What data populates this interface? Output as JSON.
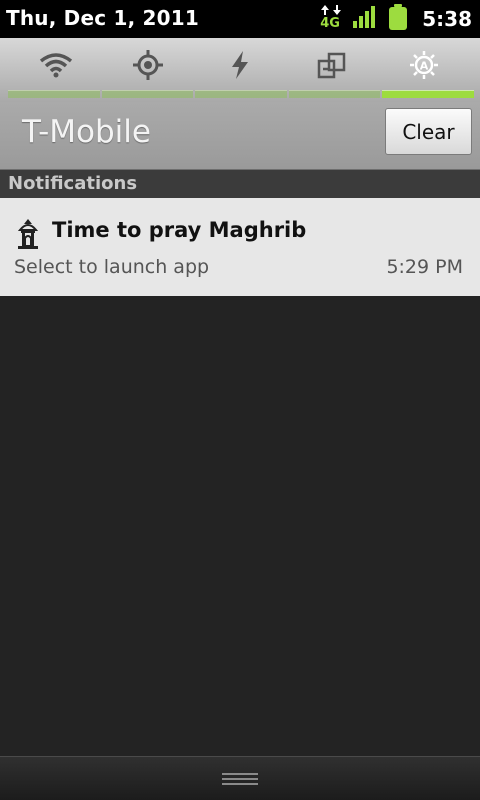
{
  "status_bar": {
    "date": "Thu, Dec 1, 2011",
    "network": "4G",
    "time": "5:38",
    "icons": [
      "data-arrows-icon",
      "4g-icon",
      "signal-icon",
      "battery-icon"
    ],
    "colors": {
      "accent": "#9ddc3f"
    }
  },
  "quick_settings": {
    "toggles": [
      "wifi-icon",
      "gps-icon",
      "power-icon",
      "data-sync-icon",
      "brightness-auto-icon"
    ],
    "active_toggle": "brightness-auto-icon"
  },
  "carrier": {
    "name": "T-Mobile",
    "clear_label": "Clear"
  },
  "notifications": {
    "header": "Notifications",
    "items": [
      {
        "icon": "mosque-icon",
        "title": "Time to pray Maghrib",
        "text": "Select to launch app",
        "time": "5:29 PM"
      }
    ]
  },
  "bottom": {
    "icon": "drag-handle-icon"
  }
}
